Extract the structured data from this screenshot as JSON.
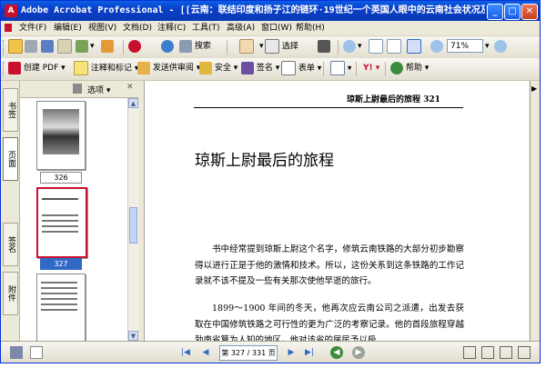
{
  "window": {
    "app_icon": "acrobat-icon",
    "title": "Adobe Acrobat Professional - [[云南：联结印度和扬子江的链环·19世纪一个英国人眼中的云南社会状况及...",
    "controls": [
      "_",
      "□",
      "✕"
    ]
  },
  "menu": [
    "文件(F)",
    "编辑(E)",
    "视图(V)",
    "文档(D)",
    "注释(C)",
    "工具(T)",
    "高级(A)",
    "窗口(W)",
    "帮助(H)"
  ],
  "toolbar1": {
    "search_label": "搜索",
    "hand_tool": "hand-tool-icon",
    "select_label": "选择",
    "zoom_value": "71%"
  },
  "toolbar2": {
    "create_pdf": "创建 PDF",
    "comment": "注释和标记",
    "send_review": "发送供审阅",
    "secure": "安全",
    "sign": "签名",
    "forms": "表单",
    "help": "帮助"
  },
  "nav_tabs": [
    "书签",
    "页面",
    "签名",
    "附件"
  ],
  "pages_pane": {
    "options_label": "选项",
    "thumbnails": [
      {
        "label": "326",
        "selected": false
      },
      {
        "label": "327",
        "selected": true
      },
      {
        "label": "",
        "selected": false
      }
    ]
  },
  "document": {
    "running_header": "琼斯上尉最后的旅程    321",
    "chapter_title": "琼斯上尉最后的旅程",
    "paragraphs": [
      "书中经常提到琼斯上尉这个名字，修筑云南铁路的大部分初步勘察得以进行正是于他的激情和技术。所以，这份关系到这条铁路的工作记录就不该不提及一些有关那次使他早逝的旅行。",
      "1899～1900 年间的冬天，他再次应云南公司之派遣，出发去获取在中国修筑铁路之可行性的更为广泛的考察记录。他的首段旅程穿越勃南省算为人知的地区，他对该省的居民予以极"
    ]
  },
  "status": {
    "page_display": "第 327 / 331 页"
  },
  "colors": {
    "titlebar": "#0b3ab4",
    "selection": "#316ac5",
    "acrobat_red": "#c8102e"
  }
}
